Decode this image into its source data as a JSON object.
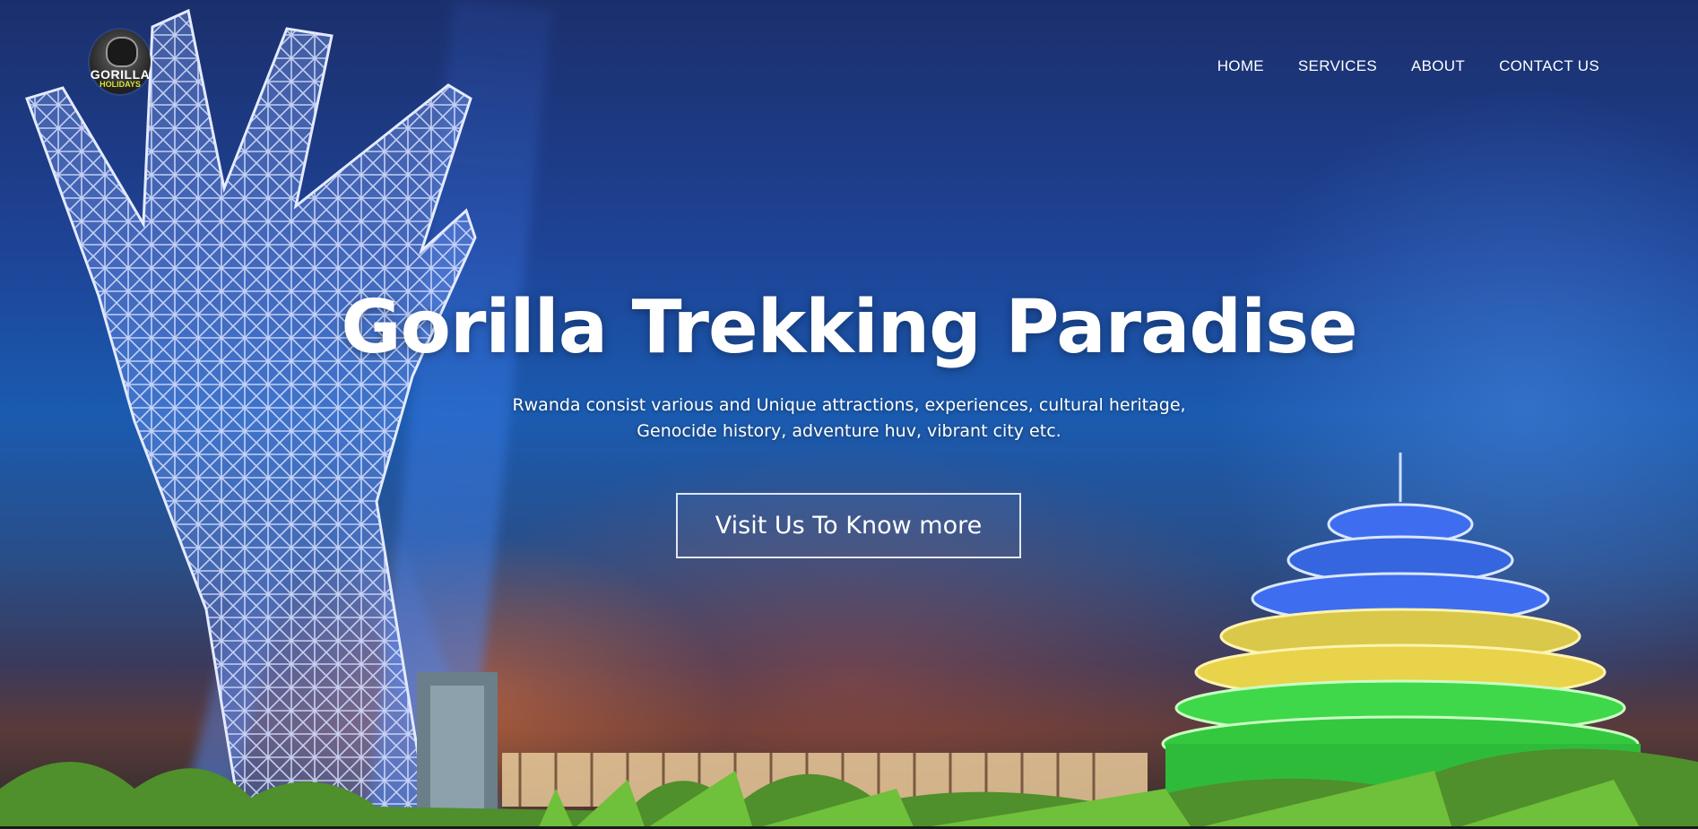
{
  "logo": {
    "text_line1": "GORILLA",
    "text_line2": "HOLIDAYS"
  },
  "nav": {
    "items": [
      {
        "label": "HOME"
      },
      {
        "label": "SERVICES"
      },
      {
        "label": "ABOUT"
      },
      {
        "label": "CONTACT US"
      }
    ]
  },
  "hero": {
    "title": "Gorilla Trekking Paradise",
    "subtitle_line1": "Rwanda consist various and Unique attractions, experiences, cultural heritage,",
    "subtitle_line2": "Genocide history, adventure huv, vibrant city etc.",
    "cta_label": "Visit Us To Know more"
  },
  "colors": {
    "sky_top": "#1b2f6c",
    "sky_mid": "#1a5bb0",
    "text": "#ffffff",
    "dome_green": "#3fd84a",
    "dome_yellow": "#e8d34a",
    "dome_blue": "#3f6df0"
  }
}
